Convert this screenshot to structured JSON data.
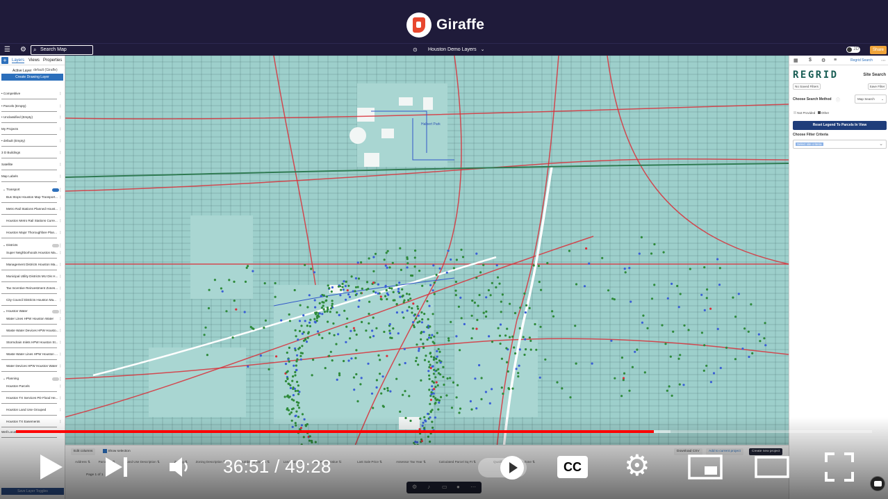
{
  "brand": {
    "name": "Giraffe"
  },
  "toolbar": {
    "search_placeholder": "Search Map",
    "project_title": "Houston Demo Layers",
    "mode_label": "2D",
    "share_label": "Share"
  },
  "left_panel": {
    "tabs": [
      "Layers",
      "Views",
      "Properties"
    ],
    "active_layer_label": "Active Layer",
    "active_layer_value": "default (Giraffe)",
    "create_button": "Create Drawing Layer",
    "rows": [
      "• Competitive",
      "• Parcels (Empty)",
      "• Unclassified (Empty)",
      "My Projects",
      "• default (Empty)",
      "3 D Buildings",
      "Satellite",
      "Map Labels",
      "Transport",
      "Bus Stops Houston Map Transport...",
      "Metro Rail Stations Planned Houst...",
      "Houston Metro Rail Stations Curre...",
      "Houston Major Thoroughfare Plan...",
      "Districts",
      "Super Neighborhoods Houston Ma...",
      "Management Districts Houston Ma...",
      "Municipal Utility Districts MU Dis H...",
      "Tax Incentive Reinvestment Zones...",
      "City Council Districts Houston Ma...",
      "Houston Water",
      "Water Lines HPW Houston Water",
      "Waste Water Devices HPW Housto...",
      "Stormdrain Inlets HPW Houston St...",
      "Waste Water Lines HPW Houston ...",
      "Water Devices HPW Houston Water",
      "Planning",
      "Houston Parcels",
      "Houston TX Services PD Flood He...",
      "Houston Land Use Grouped",
      "Houston TX Easements",
      "Well Locations Pos Public RRC Public..."
    ],
    "save_button": "Save Layer Toggles"
  },
  "right_panel": {
    "header_title": "Regrid Search",
    "logo": "REGRID",
    "site_search": "Site Search",
    "no_saved_filters": "No Saved Filters",
    "save_filter": "Save Filter",
    "choose_method": "Choose Search Method",
    "method_value": "Map Search",
    "legend_not_provided": "Not Provided",
    "legend_other": "Other",
    "reset_button": "Reset Legend To Parcels In View",
    "choose_criteria": "Choose Filter Criteria",
    "criteria_placeholder": "Select site criteria"
  },
  "table_bar": {
    "edit_columns": "Edit columns",
    "show_selection": "Show selection",
    "download_csv": "Download CSV",
    "add_to_project": "Add to current project",
    "create_project": "Create new project",
    "columns": [
      "Address",
      "Parcel ID",
      "Land Use Description",
      "Zoning",
      "Zoning Description",
      "Number of Stories",
      "Land Value",
      "Total Parcel Value",
      "Last Sale Price",
      "Assessor Tax Year",
      "Calculated Parcel Sq Ft",
      "Qualified Opportunity Zone"
    ],
    "pagination": "Page 1 of 1"
  },
  "map": {
    "label_park": "Halbert Park"
  },
  "video": {
    "current_time": "36:51",
    "duration": "49:28",
    "played_fraction": 0.745,
    "buffered_fraction": 0.765,
    "cc_label": "CC"
  }
}
